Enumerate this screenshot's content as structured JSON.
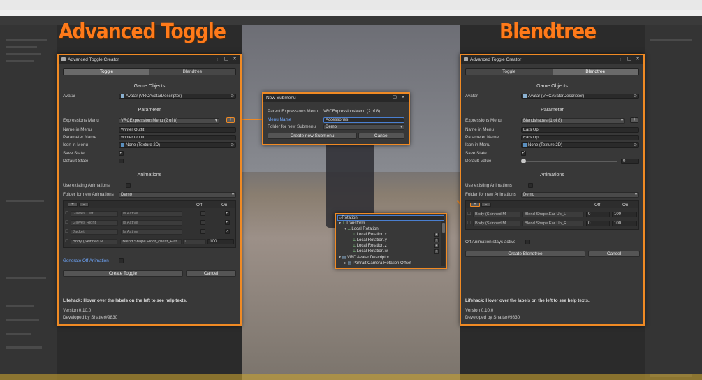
{
  "overlay": {
    "left_title": "Advanced Toggle",
    "right_title": "Blendtree"
  },
  "colors": {
    "accent": "#f08a24",
    "title_orange": "#ff7a1a",
    "panel": "#383838"
  },
  "toggle_window": {
    "title": "Advanced Toggle Creator",
    "tabs": [
      {
        "label": "Toggle",
        "selected": true
      },
      {
        "label": "Blendtree",
        "selected": false
      }
    ],
    "game_objects_header": "Game Objects",
    "avatar_label": "Avatar",
    "avatar_value": "Avatar (VRCAvatarDescriptor)",
    "parameter_header": "Parameter",
    "expressions_menu_label": "Expressions Menu",
    "expressions_menu_value": "VRCExpressionsMenu (2 of 8)",
    "add_button": "+",
    "name_in_menu_label": "Name in Menu",
    "name_in_menu_value": "Winter Outfit",
    "parameter_name_label": "Parameter Name",
    "parameter_name_value": "Winter Outfit",
    "icon_label": "Icon in Menu",
    "icon_value": "None (Texture 2D)",
    "save_state_label": "Save State",
    "save_state_checked": true,
    "default_state_label": "Default State",
    "default_state_checked": false,
    "animations_header": "Animations",
    "use_existing_label": "Use existing Animations",
    "folder_label": "Folder for new Animations",
    "folder_value": "Demo",
    "table": {
      "add_btn": "+",
      "remove_btn": "-",
      "col_off": "Off",
      "col_on": "On",
      "rows": [
        {
          "object": "Gloves Left",
          "property": "Is Active",
          "off": false,
          "on": true
        },
        {
          "object": "Gloves Right",
          "property": "Is Active",
          "off": false,
          "on": true
        },
        {
          "object": "Jacket",
          "property": "Is Active",
          "off": false,
          "on": true
        },
        {
          "object": "Body (Skinned M",
          "property": "Blend Shape.Floof_chest_Flat",
          "off_value": "0",
          "on_value": "100"
        }
      ]
    },
    "generate_off_label": "Generate Off Animation",
    "create_button": "Create Toggle",
    "cancel_button": "Cancel",
    "lifehack": "Lifehack: Hover over the labels on the left to see help texts.",
    "version": "Version 0.10.0",
    "developer": "Developed by Shatter#9830"
  },
  "submenu_window": {
    "title": "New Submenu",
    "parent_label": "Parent Expressions Menu",
    "parent_value": "VRCExpressionsMenu (2 of 8)",
    "menu_name_label": "Menu Name",
    "menu_name_value": "Accessories",
    "folder_label": "Folder for new Submenu",
    "folder_value": "Demo",
    "create_button": "Create new Submenu",
    "cancel_button": "Cancel"
  },
  "rotation_picker": {
    "search_value": "Rotation",
    "items": [
      {
        "label": "Transform",
        "level": 0,
        "expand": "down",
        "add": false
      },
      {
        "label": "Local Rotation",
        "level": 1,
        "expand": "down",
        "add": false
      },
      {
        "label": "Local Rotation.x",
        "level": 2,
        "add": true
      },
      {
        "label": "Local Rotation.y",
        "level": 2,
        "add": true
      },
      {
        "label": "Local Rotation.z",
        "level": 2,
        "add": true
      },
      {
        "label": "Local Rotation.w",
        "level": 2,
        "add": true
      },
      {
        "label": "VRC Avatar Descriptor",
        "level": 0,
        "expand": "down",
        "add": false
      },
      {
        "label": "Portrait Camera Rotation Offset",
        "level": 1,
        "expand": "right",
        "add": false
      }
    ]
  },
  "blendtree_window": {
    "title": "Advanced Toggle Creator",
    "tabs": [
      {
        "label": "Toggle",
        "selected": false
      },
      {
        "label": "Blendtree",
        "selected": true
      }
    ],
    "game_objects_header": "Game Objects",
    "avatar_label": "Avatar",
    "avatar_value": "Avatar (VRCAvatarDescriptor)",
    "parameter_header": "Parameter",
    "expressions_menu_label": "Expressions Menu",
    "expressions_menu_value": "Blendshapes (1 of 8)",
    "add_button": "+",
    "name_in_menu_label": "Name in Menu",
    "name_in_menu_value": "Ears Up",
    "parameter_name_label": "Parameter Name",
    "parameter_name_value": "Ears Up",
    "icon_label": "Icon in Menu",
    "icon_value": "None (Texture 2D)",
    "save_state_label": "Save State",
    "save_state_checked": true,
    "default_value_label": "Default Value",
    "default_value": "0",
    "default_value_fraction": 0,
    "animations_header": "Animations",
    "use_existing_label": "Use existing Animations",
    "folder_label": "Folder for new Animations",
    "folder_value": "Demo",
    "table": {
      "add_btn": "+",
      "remove_btn": "-",
      "col_off": "Off",
      "col_on": "On",
      "rows": [
        {
          "object": "Body (Skinned M",
          "property": "Blend Shape.Ear Up_L",
          "off_value": "0",
          "on_value": "100"
        },
        {
          "object": "Body (Skinned M",
          "property": "Blend Shape.Ear Up_R",
          "off_value": "0",
          "on_value": "100"
        }
      ]
    },
    "off_stays_active_label": "Off Animation stays active",
    "create_button": "Create Blendtree",
    "cancel_button": "Cancel",
    "lifehack": "Lifehack: Hover over the labels on the left to see help texts.",
    "version": "Version 0.10.0",
    "developer": "Developed by Shatter#9830"
  }
}
